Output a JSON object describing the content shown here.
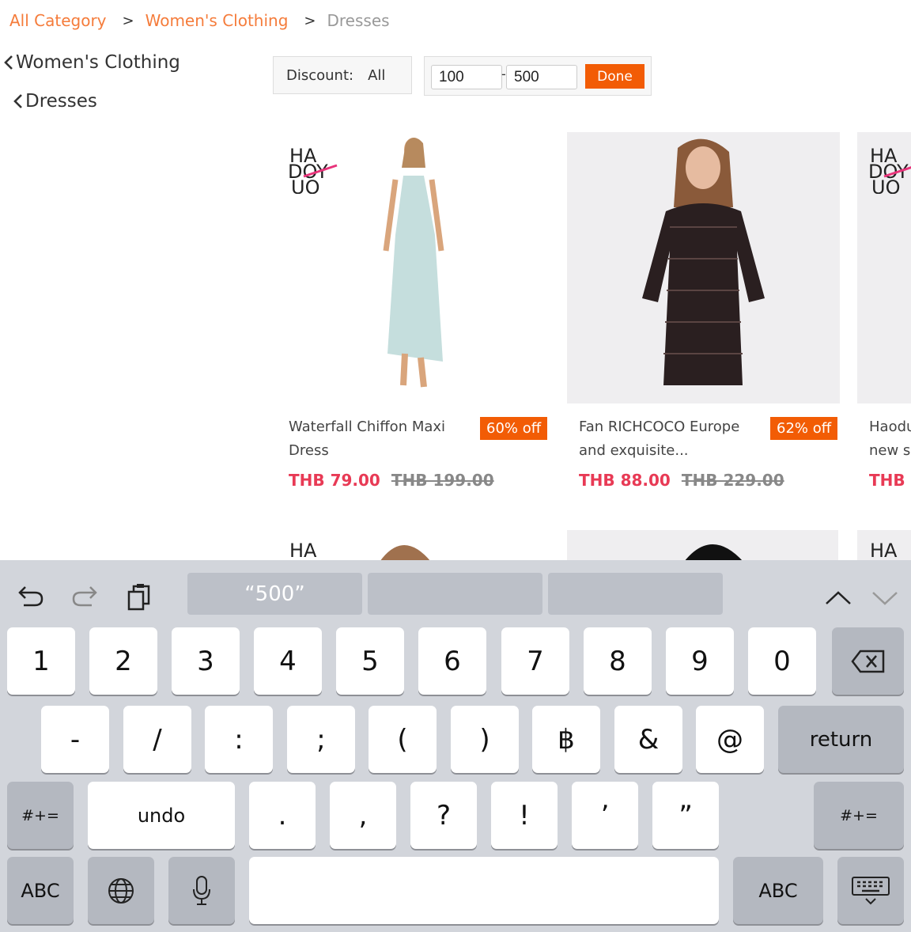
{
  "breadcrumb": {
    "items": [
      "All Category",
      "Women's Clothing",
      "Dresses"
    ],
    "separator": ">"
  },
  "sidebar": {
    "items": [
      "Women's Clothing",
      "Dresses"
    ]
  },
  "filters": {
    "discount_label": "Discount:",
    "discount_value": "All",
    "price_min": "100",
    "price_max": "500",
    "done_label": "Done"
  },
  "products": [
    {
      "name": "Waterfall Chiffon Maxi Dress",
      "discount": "60% off",
      "price": "THB 79.00",
      "old_price": "THB 199.00",
      "brand_logo": "HAOYDUO"
    },
    {
      "name": "Fan RICHCOCO Europe and exquisite...",
      "discount": "62% off",
      "price": "THB 88.00",
      "old_price": "THB 229.00"
    },
    {
      "name": "Haodu new s",
      "price": "THB",
      "brand_logo": "HAOYDUO"
    }
  ],
  "keyboard": {
    "suggestions": [
      "“500”",
      "",
      ""
    ],
    "row1": [
      "1",
      "2",
      "3",
      "4",
      "5",
      "6",
      "7",
      "8",
      "9",
      "0"
    ],
    "row2": [
      "-",
      "/",
      ":",
      ";",
      "(",
      ")",
      "฿",
      "&",
      "@"
    ],
    "return_label": "return",
    "row3_left": "#+=",
    "undo_label": "undo",
    "row3": [
      ".",
      ",",
      "?",
      "!",
      "’",
      "”"
    ],
    "row3_right": "#+=",
    "abc_left": "ABC",
    "abc_right": "ABC",
    "icons": [
      "undo-icon",
      "redo-icon",
      "clipboard-icon",
      "chevron-up-icon",
      "chevron-down-icon",
      "backspace-icon",
      "globe-icon",
      "microphone-icon",
      "keyboard-dismiss-icon"
    ]
  },
  "colors": {
    "accent": "#f25c05",
    "breadcrumb_link": "#f57c3b",
    "price": "#e83a55",
    "keyboard_bg": "#d2d5db"
  }
}
